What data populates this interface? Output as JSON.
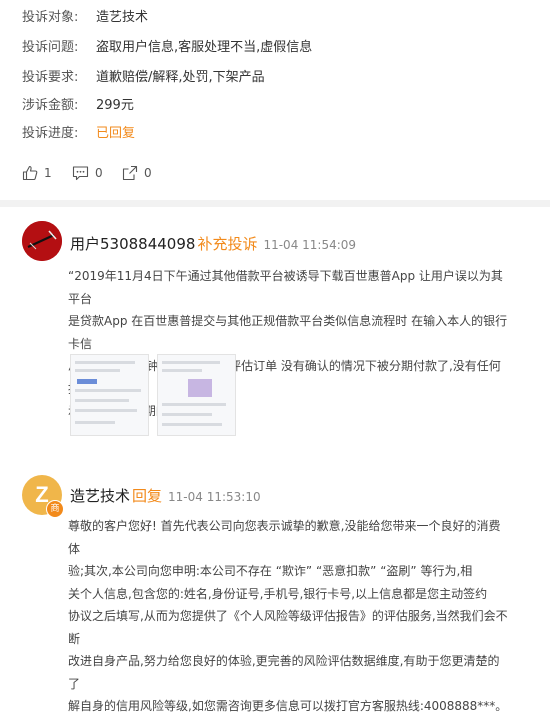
{
  "complaint_info": {
    "rows": [
      {
        "label": "投诉对象:",
        "value": "造艺技术"
      },
      {
        "label": "投诉问题:",
        "value": "盗取用户信息,客服处理不当,虚假信息"
      },
      {
        "label": "投诉要求:",
        "value": "道歉赔偿/解释,处罚,下架产品"
      },
      {
        "label": "涉诉金额:",
        "value": "299元"
      },
      {
        "label": "投诉进度:",
        "value": "已回复"
      }
    ]
  },
  "actions": {
    "like_count": "1",
    "comment_count": "0",
    "share_count": "0"
  },
  "colors": {
    "accent": "#f28a1b",
    "divider": "#f2f2f2"
  },
  "posts": [
    {
      "user": "用户5308844098",
      "type": "补充投诉",
      "time": "11-04 11:54:09",
      "lines": [
        "“2019年11月4日下午通过其他借款平台被诱导下载百世惠普App 让用户误以为其平台",
        "是贷款App 在百世惠普提交与其他正规借款平台类似信息流程时 在输入本人的银行卡信",
        "息后, app几分钟内生成299元评估订单 没有确认的情况下被分期付款了,没有任何提",
        "示,自动贷款分期的吗?"
      ]
    },
    {
      "user": "造艺技术",
      "type": "回复",
      "time": "11-04 11:53:10",
      "avatar_letter": "Z",
      "avatar_badge": "商",
      "lines": [
        "尊敬的客户您好! 首先代表公司向您表示诚挚的歉意,没能给您带来一个良好的消费体",
        "验;其次,本公司向您申明:本公司不存在 “欺诈” “恶意扣款” “盗刷” 等行为,相",
        "关个人信息,包含您的:姓名,身份证号,手机号,银行卡号,以上信息都是您主动签约",
        "协议之后填写,从而为您提供了《个人风险等级评估报告》的评估服务,当然我们会不断",
        "改进自身产品,努力给您良好的体验,更完善的风险评估数据维度,有助于您更清楚的了",
        "解自身的信用风险等级,如您需咨询更多信息可以拨打官方客服热线:4008888***。"
      ]
    }
  ]
}
